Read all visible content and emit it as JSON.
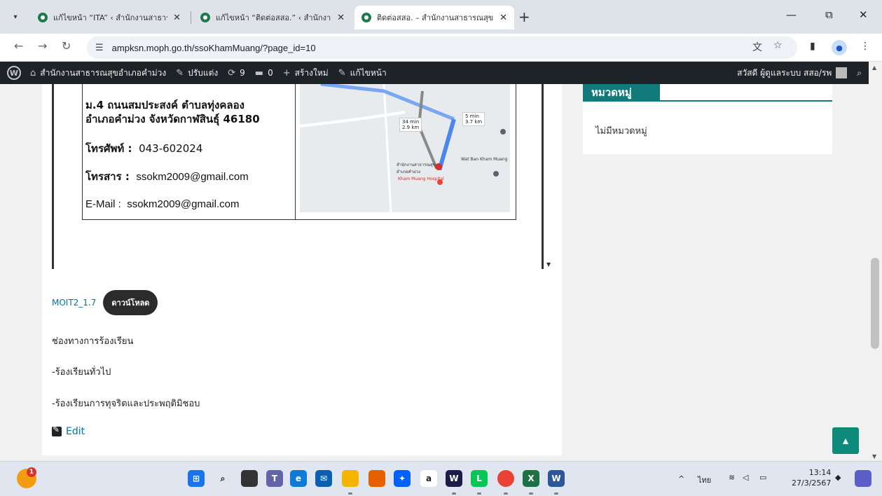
{
  "browser": {
    "tabs": [
      {
        "title": "แก้ไขหน้า “ITA” ‹ สำนักงานสาธารณ",
        "close": "✕"
      },
      {
        "title": "แก้ไขหน้า “ติดต่อสสอ.” ‹ สำนักงานส",
        "close": "✕"
      },
      {
        "title": "ติดต่อสสอ. – สำนักงานสาธารณสุขอ",
        "close": "✕"
      }
    ],
    "new_tab": "+",
    "url": "ampksn.moph.go.th/ssoKhamMuang/?page_id=10",
    "win_min": "—",
    "win_restore": "⧉",
    "win_close": "✕"
  },
  "wpbar": {
    "logo": "W",
    "site_name": "สำนักงานสาธารณสุขอำเภอคำม่วง",
    "customize": "ปรับแต่ง",
    "updates_count": "9",
    "comments_count": "0",
    "new": "สร้างใหม่",
    "edit_page": "แก้ไขหน้า",
    "greeting": "สวัสดี ผู้ดูแลระบบ สสอ/รพ"
  },
  "contact": {
    "address_line1": "ม.4  ถนนสมประสงค์  ตำบลทุ่งคลอง",
    "address_line2": "อำเภอคำม่วง  จังหวัดกาฬสินธุ์   46180",
    "phone_label": "โทรศัพท์ :",
    "phone": "043-602024",
    "fax_label": "โทรสาร :",
    "fax": "ssokm2009@gmail.com",
    "email_label": "E-Mail :",
    "email": "ssokm2009@gmail.com"
  },
  "map": {
    "walk_time": "34 min",
    "walk_dist": "2.9 km",
    "drive_time": "5 min",
    "drive_dist": "3.7 km",
    "place1": "สำนักงานสาธารณสุข อำเภอคำม่วง",
    "place2": "Kham Muang Hospital",
    "place3": "Wat Ban Kham Muang"
  },
  "download": {
    "link": "MOIT2_1.7",
    "button": "ดาวน์โหลด"
  },
  "paragraphs": {
    "channels": "ช่องทางการร้องเรียน",
    "general": "-ร้องเรียนทั่วไป",
    "corruption": "-ร้องเรียนการทุจริตและประพฤติมิชอบ"
  },
  "edit_label": "Edit",
  "sidebar": {
    "widget_title": "หมวดหมู่",
    "empty_text": "ไม่มีหมวดหมู่"
  },
  "taskbar": {
    "weather_badge": "1",
    "lang": "ไทย",
    "time": "13:14",
    "date": "27/3/2567"
  }
}
